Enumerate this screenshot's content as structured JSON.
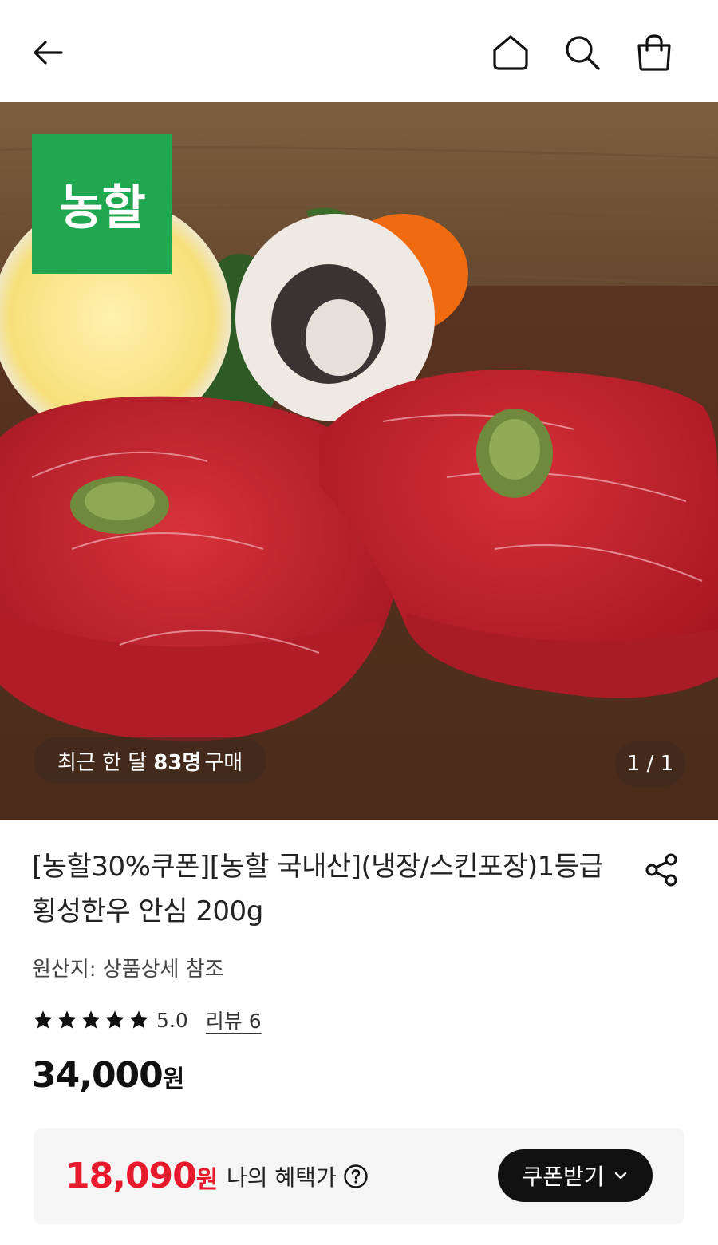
{
  "header": {
    "back_icon": "arrow-left-icon",
    "home_icon": "home-icon",
    "search_icon": "search-icon",
    "cart_icon": "shopping-bag-icon"
  },
  "hero": {
    "brand_badge": "농할",
    "buyers_prefix": "최근 한 달",
    "buyers_count": "83명",
    "buyers_suffix": "구매",
    "page_indicator": "1 / 1"
  },
  "product": {
    "title": "[농할30%쿠폰][농할 국내산](냉장/스킨포장)1등급 횡성한우 안심 200g",
    "share_icon": "share-icon",
    "origin": "원산지: 상품상세 참조",
    "rating": {
      "stars": 5,
      "score": "5.0",
      "review_label": "리뷰 6"
    },
    "price": "34,000",
    "price_unit": "원"
  },
  "benefit": {
    "price": "18,090",
    "price_unit": "원",
    "label": "나의 혜택가",
    "help_icon": "question-circle-icon",
    "coupon_button": "쿠폰받기",
    "coupon_icon": "chevron-down-icon"
  },
  "colors": {
    "brand_green": "#1fa84f",
    "benefit_red": "#e8192c",
    "button_black": "#111111"
  }
}
